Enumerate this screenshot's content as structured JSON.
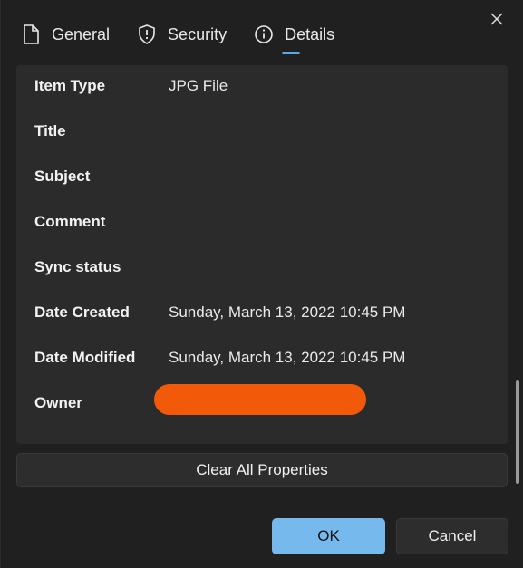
{
  "tabs": [
    {
      "label": "General",
      "icon": "document-icon"
    },
    {
      "label": "Security",
      "icon": "shield-icon"
    },
    {
      "label": "Details",
      "icon": "info-icon",
      "active": true
    }
  ],
  "properties": [
    {
      "key": "Item Type",
      "value": "JPG File"
    },
    {
      "key": "Title",
      "value": ""
    },
    {
      "key": "Subject",
      "value": ""
    },
    {
      "key": "Comment",
      "value": ""
    },
    {
      "key": "Sync status",
      "value": ""
    },
    {
      "key": "Date Created",
      "value": "Sunday, March 13, 2022 10:45 PM"
    },
    {
      "key": "Date Modified",
      "value": "Sunday, March 13, 2022 10:45 PM"
    },
    {
      "key": "Owner",
      "value": ""
    }
  ],
  "buttons": {
    "clear_all": "Clear All Properties",
    "ok": "OK",
    "cancel": "Cancel"
  },
  "colors": {
    "accent": "#76b9ed",
    "tab_underline": "#5ea7e6",
    "redaction": "#f25a0a",
    "background": "#202020",
    "panel": "#2b2b2b"
  }
}
